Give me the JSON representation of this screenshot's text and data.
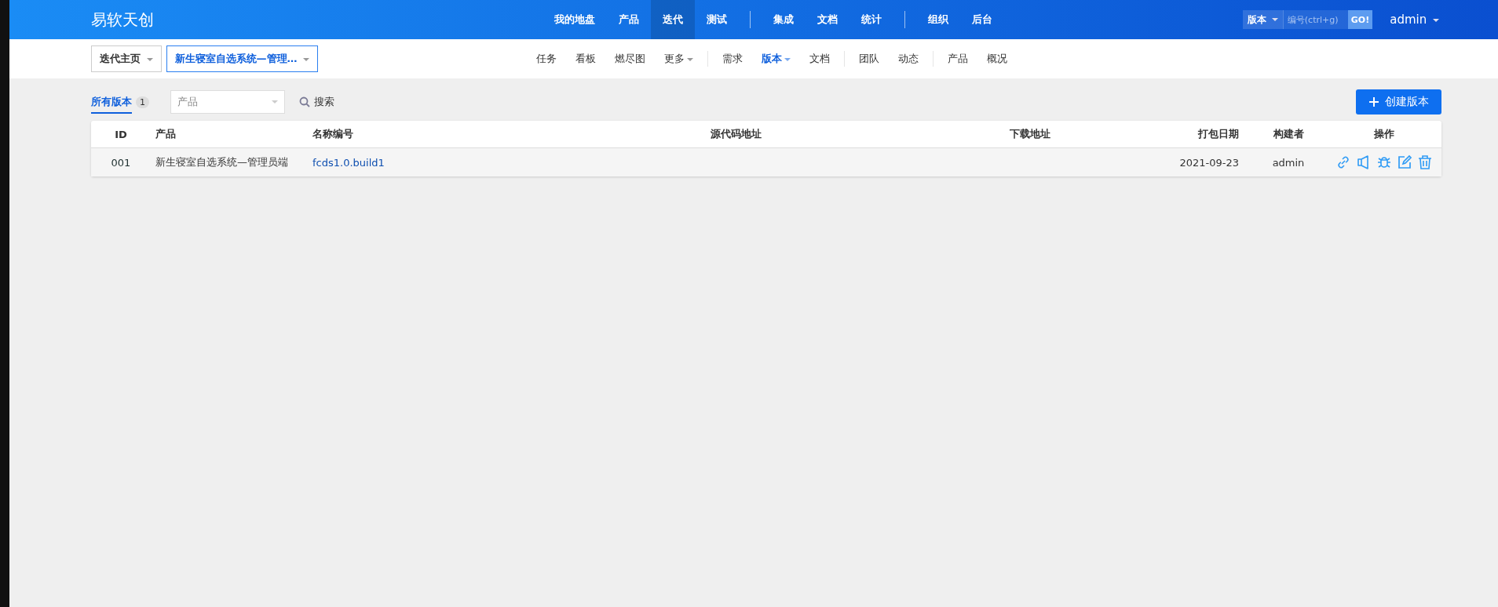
{
  "brand": "易软天创",
  "main_nav": [
    {
      "kind": "item",
      "label": "我的地盘",
      "selected": false
    },
    {
      "kind": "item",
      "label": "产品",
      "selected": false
    },
    {
      "kind": "item",
      "label": "迭代",
      "selected": true
    },
    {
      "kind": "item",
      "label": "测试",
      "selected": false
    },
    {
      "kind": "separator"
    },
    {
      "kind": "item",
      "label": "集成",
      "selected": false
    },
    {
      "kind": "item",
      "label": "文档",
      "selected": false
    },
    {
      "kind": "item",
      "label": "统计",
      "selected": false
    },
    {
      "kind": "separator"
    },
    {
      "kind": "item",
      "label": "组织",
      "selected": false
    },
    {
      "kind": "item",
      "label": "后台",
      "selected": false
    }
  ],
  "quick_search": {
    "type_label": "版本",
    "placeholder": "编号(ctrl+g)",
    "go": "GO!"
  },
  "user": "admin",
  "breadcrumbs": [
    {
      "label": "迭代主页",
      "selected": false
    },
    {
      "label": "新生寝室自选系统—管理…",
      "selected": true
    }
  ],
  "sub_nav": [
    {
      "kind": "item",
      "label": "任务",
      "selected": false,
      "dropdown": false
    },
    {
      "kind": "item",
      "label": "看板",
      "selected": false,
      "dropdown": false
    },
    {
      "kind": "item",
      "label": "燃尽图",
      "selected": false,
      "dropdown": false
    },
    {
      "kind": "item",
      "label": "更多",
      "selected": false,
      "dropdown": true
    },
    {
      "kind": "separator"
    },
    {
      "kind": "item",
      "label": "需求",
      "selected": false,
      "dropdown": false
    },
    {
      "kind": "item",
      "label": "版本",
      "selected": true,
      "dropdown": true
    },
    {
      "kind": "item",
      "label": "文档",
      "selected": false,
      "dropdown": false
    },
    {
      "kind": "separator"
    },
    {
      "kind": "item",
      "label": "团队",
      "selected": false,
      "dropdown": false
    },
    {
      "kind": "item",
      "label": "动态",
      "selected": false,
      "dropdown": false
    },
    {
      "kind": "separator"
    },
    {
      "kind": "item",
      "label": "产品",
      "selected": false,
      "dropdown": false
    },
    {
      "kind": "item",
      "label": "概况",
      "selected": false,
      "dropdown": false
    }
  ],
  "toolbar": {
    "tab": {
      "label": "所有版本",
      "count": "1",
      "selected": true
    },
    "product_select": {
      "placeholder": "产品"
    },
    "search": "搜索",
    "create_button": "创建版本"
  },
  "table": {
    "columns": [
      "ID",
      "产品",
      "名称编号",
      "源代码地址",
      "下载地址",
      "打包日期",
      "构建者",
      "操作"
    ],
    "rows": [
      {
        "id": "001",
        "product": "新生寝室自选系统—管理员端",
        "name": "fcds1.0.build1",
        "date": "2021-09-23",
        "builder": "admin",
        "actions": [
          {
            "kind": "link"
          },
          {
            "kind": "release"
          },
          {
            "kind": "bug"
          },
          {
            "kind": "edit"
          },
          {
            "kind": "delete"
          }
        ]
      }
    ]
  }
}
